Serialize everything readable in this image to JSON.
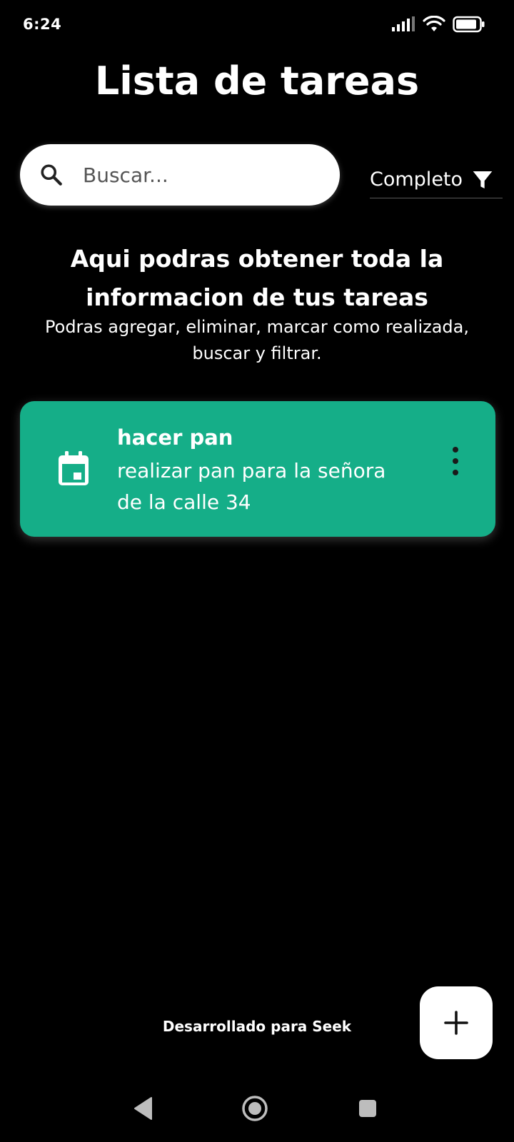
{
  "status_bar": {
    "time": "6:24",
    "battery_level": "83"
  },
  "header": {
    "title": "Lista de tareas"
  },
  "search": {
    "placeholder": "Buscar...",
    "value": "",
    "icon": "search-icon"
  },
  "filter": {
    "selected": "Completo",
    "icon": "filter-icon"
  },
  "info": {
    "heading": "Aqui podras obtener toda la informacion de tus tareas",
    "subtext": "Podras agregar, eliminar, marcar como realizada, buscar y filtrar."
  },
  "tasks": [
    {
      "title": "hacer pan",
      "description": "realizar pan para la señora de la calle 34",
      "icon": "calendar-icon",
      "color": "#15ae88"
    }
  ],
  "footer": {
    "text": "Desarrollado para Seek"
  },
  "fab": {
    "label": "+",
    "icon": "plus-icon"
  },
  "nav": {
    "back": "back-icon",
    "home": "home-icon",
    "recents": "recents-icon"
  },
  "colors": {
    "background": "#000000",
    "accent": "#15ae88",
    "surface": "#ffffff"
  }
}
